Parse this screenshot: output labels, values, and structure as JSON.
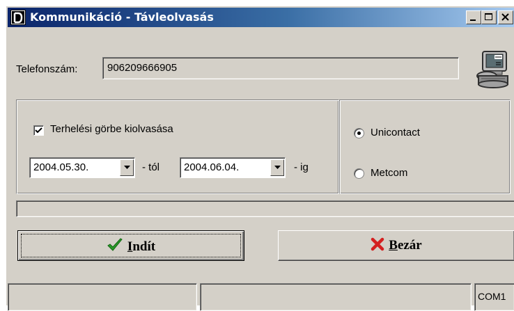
{
  "window": {
    "title": "Kommunikáció - Távleolvasás",
    "title_bar_buttons": [
      "minimize-icon",
      "maximize-icon",
      "close-icon"
    ]
  },
  "phone": {
    "label": "Telefonszám:",
    "value": "906209666905",
    "icon": "network-computer-icon"
  },
  "load_curve": {
    "checkbox_label": "Terhelési görbe kiolvasása",
    "checked": true,
    "from_date": "2004.05.30.",
    "from_suffix": "- tól",
    "to_date": "2004.06.04.",
    "to_suffix": "- ig"
  },
  "protocol": {
    "options": [
      "Unicontact",
      "Metcom"
    ],
    "selected": "Unicontact"
  },
  "progress": {
    "value": 0
  },
  "buttons": {
    "start_first_letter": "I",
    "start_rest": "ndít",
    "close_first_letter": "B",
    "close_rest": "ezár"
  },
  "statusbar": {
    "panel1": "",
    "panel2": "",
    "port": "COM1"
  },
  "colors": {
    "titlebar_start": "#0a246a",
    "titlebar_end": "#a6caf0",
    "face": "#d4d0c8",
    "check_green": "#2a9a2a",
    "close_red": "#d42020"
  }
}
